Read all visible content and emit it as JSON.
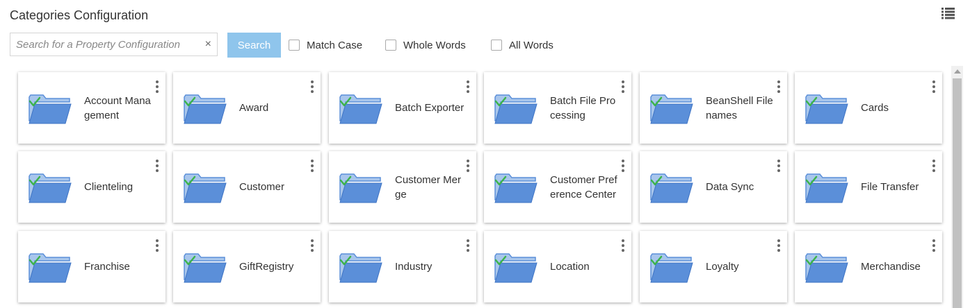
{
  "header": {
    "title": "Categories Configuration",
    "view_toggle_icon": "list-view-icon"
  },
  "search": {
    "placeholder": "Search for a Property Configuration",
    "value": "",
    "clear_glyph": "×",
    "button_label": "Search"
  },
  "options": [
    {
      "label": "Match Case",
      "checked": false
    },
    {
      "label": "Whole Words",
      "checked": false
    },
    {
      "label": "All Words",
      "checked": false
    }
  ],
  "tiles": [
    {
      "label": "Account Management"
    },
    {
      "label": "Award"
    },
    {
      "label": "Batch Exporter"
    },
    {
      "label": "Batch File Processing"
    },
    {
      "label": "BeanShell Filenames"
    },
    {
      "label": "Cards"
    },
    {
      "label": "Clienteling"
    },
    {
      "label": "Customer"
    },
    {
      "label": "Customer Merge"
    },
    {
      "label": "Customer Preference Center"
    },
    {
      "label": "Data Sync"
    },
    {
      "label": "File Transfer"
    },
    {
      "label": "Franchise"
    },
    {
      "label": "GiftRegistry"
    },
    {
      "label": "Industry"
    },
    {
      "label": "Location"
    },
    {
      "label": "Loyalty"
    },
    {
      "label": "Merchandise"
    }
  ],
  "colors": {
    "search_button": "#8fc5ec",
    "folder_blue": "#5b8fd9",
    "check_green": "#3cb44b"
  }
}
